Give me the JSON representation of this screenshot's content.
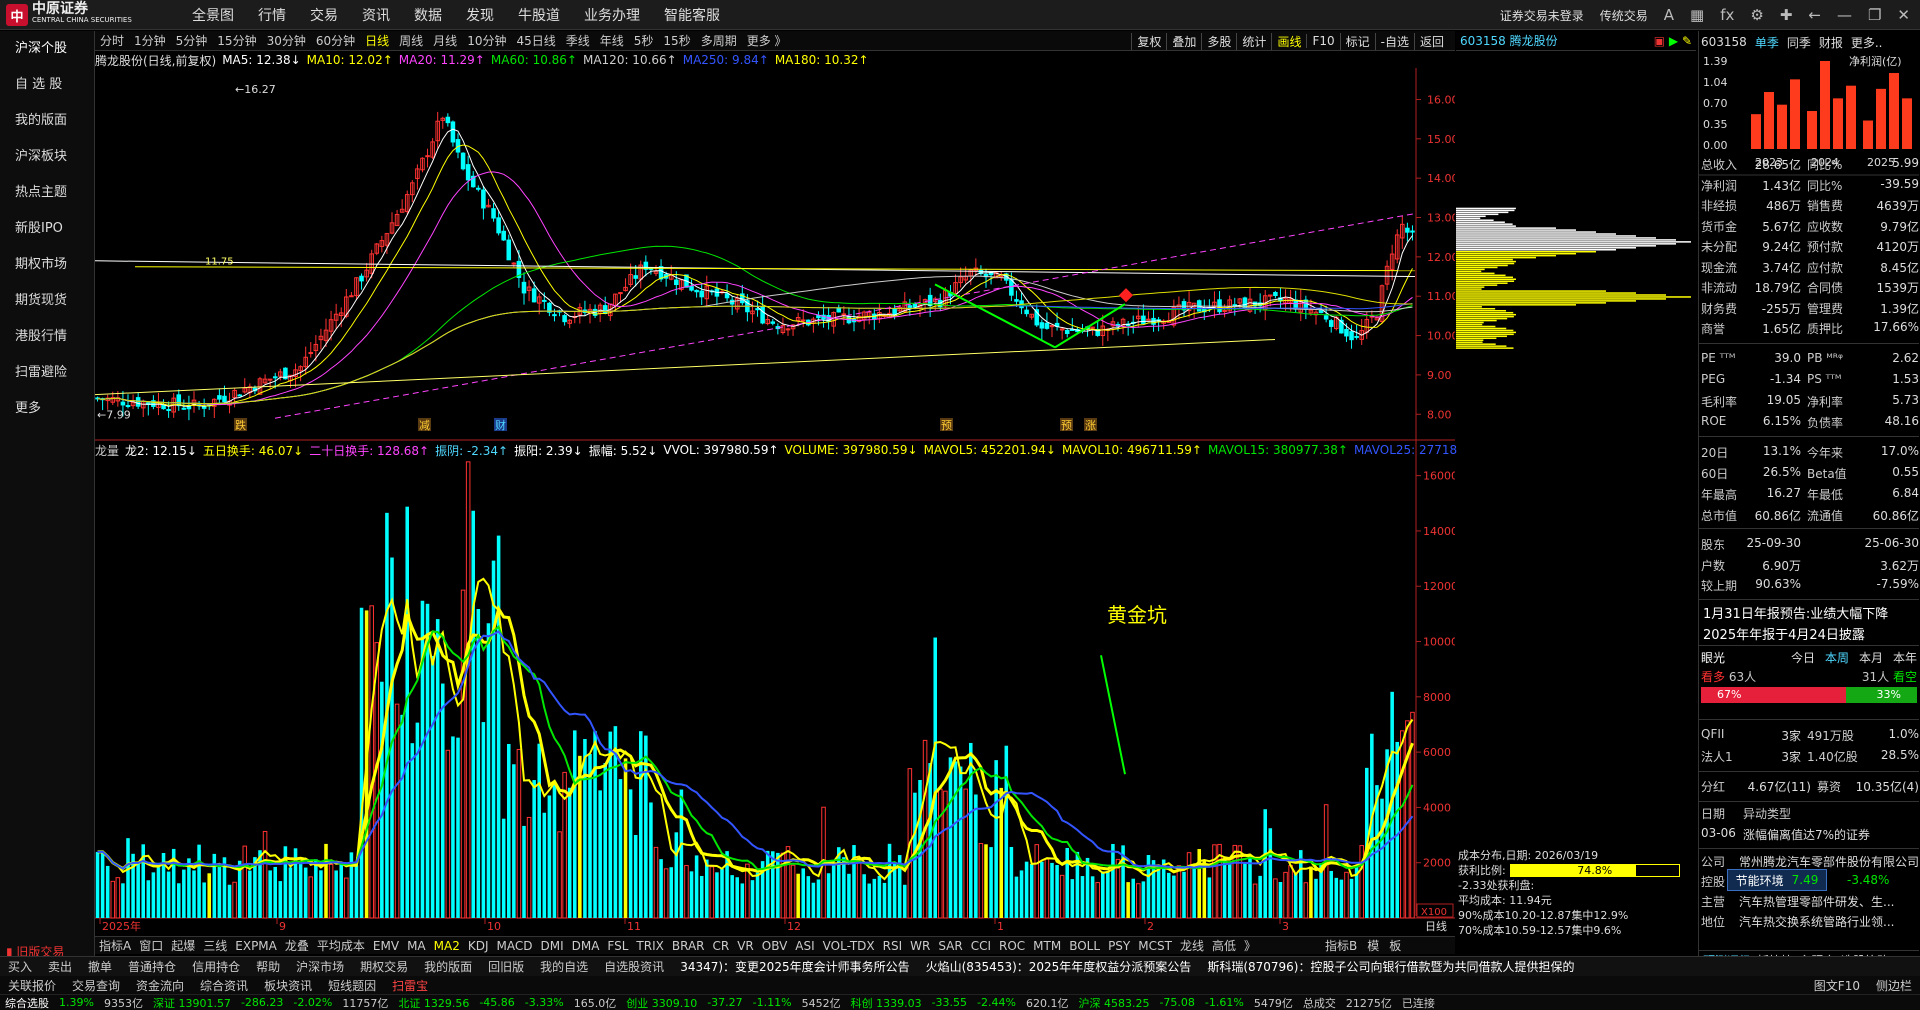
{
  "app": {
    "logo_text": "中原证券",
    "logo_sub": "CENTRAL CHINA SECURITIES"
  },
  "menu": [
    "全景图",
    "行情",
    "交易",
    "资讯",
    "数据",
    "发现",
    "牛股道",
    "业务办理",
    "智能客服"
  ],
  "topright": {
    "login": "证券交易未登录",
    "mode": "传统交易"
  },
  "leftnav": [
    "沪深个股",
    "自 选 股",
    "我的版面",
    "沪深板块",
    "热点主题",
    "新股IPO",
    "期权市场",
    "期货现货",
    "港股行情",
    "扫雷避险",
    "更多"
  ],
  "oldversion": "旧版交易",
  "periods": [
    "分时",
    "1分钟",
    "5分钟",
    "15分钟",
    "30分钟",
    "60分钟",
    "日线",
    "周线",
    "月线",
    "10分钟",
    "45日线",
    "季线",
    "年线",
    "5秒",
    "15秒",
    "多周期",
    "更多 》"
  ],
  "active_period": "日线",
  "chart_tools": [
    "复权",
    "叠加",
    "多股",
    "统计",
    "画线",
    "F10",
    "标记",
    "-自选",
    "返回"
  ],
  "stock": {
    "code": "603158",
    "name": "腾龙股份",
    "title": "腾龙股份(日线,前复权)"
  },
  "ma_legend": [
    {
      "text": "MA5: 12.38↓",
      "color": "#ffffff"
    },
    {
      "text": "MA10: 12.02↑",
      "color": "#ffff00"
    },
    {
      "text": "MA20: 11.29↑",
      "color": "#ff44ff"
    },
    {
      "text": "MA60: 10.86↑",
      "color": "#00e600"
    },
    {
      "text": "MA120: 10.66↑",
      "color": "#cccccc"
    },
    {
      "text": "MA250: 9.84↑",
      "color": "#3355ff"
    },
    {
      "text": "MA180: 10.32↑",
      "color": "#ffff00"
    }
  ],
  "vol_legend": [
    {
      "text": "龙量",
      "color": "#cccccc"
    },
    {
      "text": "龙2: 12.15↓",
      "color": "#ffffff"
    },
    {
      "text": "五日换手: 46.07↓",
      "color": "#ffff00"
    },
    {
      "text": "二十日换手: 128.68↑",
      "color": "#ff44ff"
    },
    {
      "text": "振阴: -2.34↑",
      "color": "#4fd8ff"
    },
    {
      "text": "振阳: 2.39↓",
      "color": "#ffffff"
    },
    {
      "text": "振幅: 5.52↓",
      "color": "#ffffff"
    },
    {
      "text": "VVOL: 397980.59↑",
      "color": "#ffffff"
    },
    {
      "text": "VOLUME: 397980.59↓",
      "color": "#ffff00"
    },
    {
      "text": "MAVOL5: 452201.94↓",
      "color": "#ffff00"
    },
    {
      "text": "MAVOL10: 496711.59↑",
      "color": "#ffff00"
    },
    {
      "text": "MAVOL15: 380977.38↑",
      "color": "#00e600"
    },
    {
      "text": "MAVOL25: 27718",
      "color": "#3355ff"
    }
  ],
  "price_axis": [
    "16.00",
    "15.00",
    "14.00",
    "13.00",
    "12.00",
    "11.00",
    "10.00",
    "9.00",
    "8.00"
  ],
  "vol_axis": [
    "16000",
    "14000",
    "12000",
    "10000",
    "8000",
    "6000",
    "4000",
    "2000"
  ],
  "vol_unit": "X100",
  "x_axis": [
    "2025年",
    "9",
    "10",
    "11",
    "12",
    "1",
    "2",
    "3"
  ],
  "x_right": "日线",
  "annotations": {
    "high": "16.27",
    "low": "7.99",
    "line_val": "11.75",
    "gold": "黄金坑",
    "marks": [
      "跌",
      "减",
      "财",
      "预",
      "预",
      "涨"
    ]
  },
  "chart_data": {
    "type": "candlestick",
    "title": "腾龙股份(日线,前复权)",
    "ylim": [
      7.6,
      16.8
    ],
    "high": 16.27,
    "low": 7.99,
    "volume_ylim": [
      0,
      17000
    ]
  },
  "indicator_tabs": [
    "指标A",
    "窗口",
    "起爆",
    "三线",
    "EXPMA",
    "龙叠",
    "平均成本",
    "EMV",
    "MA",
    "MA2",
    "KDJ",
    "MACD",
    "DMI",
    "DMA",
    "FSL",
    "TRIX",
    "BRAR",
    "CR",
    "VR",
    "OBV",
    "ASI",
    "VOL-TDX",
    "RSI",
    "WR",
    "SAR",
    "CCI",
    "ROC",
    "MTM",
    "BOLL",
    "PSY",
    "MCST",
    "龙线",
    "高低",
    "》"
  ],
  "active_indicator": "MA2",
  "ind_right": [
    "指标B",
    "模",
    "板"
  ],
  "bar2": [
    "买入",
    "卖出",
    "撤单",
    "普通持仓",
    "信用持仓",
    "帮助",
    "沪深市场",
    "期权交易",
    "我的版面",
    "回旧版",
    "我的自选",
    "自选股资讯",
    "34347)：变更2025年度会计师事务所公告",
    "火焰山(835453)：2025年年度权益分派预案公告",
    "斯科瑞(870796)：控股子公司向银行借款暨为共同借款人提供担保的"
  ],
  "bar3": [
    "关联报价",
    "交易查询",
    "资金流向",
    "综合资讯",
    "板块资讯",
    "短线题因",
    "扫雷宝"
  ],
  "bar3_right": [
    "图文F10",
    "侧边栏"
  ],
  "bar4": [
    {
      "t": "综合选股",
      "c": "#ffffff"
    },
    {
      "t": "1.39%",
      "c": "#00e600"
    },
    {
      "t": "9353亿",
      "c": "#cccccc"
    },
    {
      "t": "深证 13901.57",
      "c": "#00e600"
    },
    {
      "t": "-286.23",
      "c": "#00e600"
    },
    {
      "t": "-2.02%",
      "c": "#00e600"
    },
    {
      "t": "11757亿",
      "c": "#cccccc"
    },
    {
      "t": "北证 1329.56",
      "c": "#00e600"
    },
    {
      "t": "-45.86",
      "c": "#00e600"
    },
    {
      "t": "-3.33%",
      "c": "#00e600"
    },
    {
      "t": "165.0亿",
      "c": "#cccccc"
    },
    {
      "t": "创业 3309.10",
      "c": "#00e600"
    },
    {
      "t": "-37.27",
      "c": "#00e600"
    },
    {
      "t": "-1.11%",
      "c": "#00e600"
    },
    {
      "t": "5452亿",
      "c": "#cccccc"
    },
    {
      "t": "科创 1339.03",
      "c": "#00e600"
    },
    {
      "t": "-33.55",
      "c": "#00e600"
    },
    {
      "t": "-2.44%",
      "c": "#00e600"
    },
    {
      "t": "620.1亿",
      "c": "#cccccc"
    },
    {
      "t": "沪深 4583.25",
      "c": "#00e600"
    },
    {
      "t": "-75.08",
      "c": "#00e600"
    },
    {
      "t": "-1.61%",
      "c": "#00e600"
    },
    {
      "t": "5479亿",
      "c": "#cccccc"
    },
    {
      "t": "总成交",
      "c": "#cccccc"
    },
    {
      "t": "21275亿",
      "c": "#cccccc"
    },
    {
      "t": "已连接",
      "c": "#cccccc"
    }
  ],
  "chip": {
    "header": "603158 腾龙股份",
    "date": "成本分布,日期: 2026/03/19",
    "profit_label": "获利比例:",
    "profit_pct": "74.8%",
    "profit_frac": 0.748,
    "loss": "-2.33处获利盘:",
    "avg": "平均成本: 11.94元",
    "c90": "90%成本10.20-12.87集中12.9%",
    "c70": "70%成本10.59-12.57集中9.6%"
  },
  "right": {
    "code": "603158",
    "tabs": [
      "单季",
      "同季",
      "财报",
      "更多.."
    ],
    "tab_active": "单季",
    "bar_title": "净利润(亿)",
    "bar_yticks": [
      "1.39",
      "1.04",
      "0.70",
      "0.35",
      "0.00"
    ],
    "bar_xticks": [
      "2023",
      "2024",
      "2025"
    ],
    "bar_values": [
      0.55,
      0.9,
      0.7,
      1.1,
      0.6,
      1.39,
      0.8,
      1.0,
      0.45,
      0.95,
      1.2,
      0.8
    ],
    "fin": [
      [
        "总收入",
        "28.65亿",
        "同比%",
        "5.99"
      ],
      [
        "净利润",
        "1.43亿",
        "同比%",
        "-39.59"
      ],
      [
        "非经损",
        "486万",
        "销售费",
        "4639万"
      ],
      [
        "货币金",
        "5.67亿",
        "应收数",
        "9.79亿"
      ],
      [
        "未分配",
        "9.24亿",
        "预付款",
        "4120万"
      ],
      [
        "现金流",
        "3.74亿",
        "应付款",
        "8.45亿"
      ],
      [
        "非流动",
        "18.79亿",
        "合同债",
        "1539万"
      ],
      [
        "财务费",
        "-255万",
        "管理费",
        "1.39亿"
      ],
      [
        "商誉",
        "1.65亿",
        "质押比",
        "17.66%"
      ]
    ],
    "fin2": [
      [
        "PE ᵀᵀᴹ",
        "39.0",
        "PB ᴹᴿᵠ",
        "2.62"
      ],
      [
        "PEG",
        "-1.34",
        "PS ᵀᵀᴹ",
        "1.53"
      ],
      [
        "毛利率",
        "19.05",
        "净利率",
        "5.73"
      ],
      [
        "ROE",
        "6.15%",
        "负债率",
        "48.16"
      ]
    ],
    "fin3": [
      [
        "20日",
        "13.1%",
        "今年来",
        "17.0%"
      ],
      [
        "60日",
        "26.5%",
        "Beta值",
        "0.55"
      ],
      [
        "年最高",
        "16.27",
        "年最低",
        "6.84"
      ],
      [
        "总市值",
        "60.86亿",
        "流通值",
        "60.86亿"
      ]
    ],
    "fin4": [
      [
        "股东",
        "25-09-30",
        "",
        "25-06-30"
      ],
      [
        "户数",
        "6.90万",
        "",
        "3.62万"
      ],
      [
        "较上期",
        "90.63%",
        "",
        "-7.59%"
      ]
    ],
    "notice1": "1月31日年报预告:业绩大幅下降",
    "notice2": "2025年年报于4月24日披露",
    "eye": {
      "label": "眼光",
      "tabs": [
        "今日",
        "本周",
        "本月",
        "本年"
      ],
      "active": "本周",
      "bull": "看多",
      "bull_n": "63人",
      "bear_n": "31人",
      "bear": "看空",
      "bull_pct": "67%",
      "bear_pct": "33%",
      "bull_frac": 0.67
    },
    "qfii": [
      [
        "QFII",
        "3家",
        "491万股",
        "1.0%"
      ],
      [
        "法人1",
        "3家",
        "1.40亿股",
        "28.5%"
      ]
    ],
    "fenhong": [
      "分红",
      "4.67亿(11)",
      "募资",
      "10.35亿(4)"
    ],
    "event": {
      "k1": "日期",
      "v1": "异动类型",
      "k2": "03-06",
      "v2": "涨幅偏离值达7%的证券"
    },
    "company": [
      [
        "公司",
        "常州腾龙汽车零部件股份有限公司"
      ],
      [
        "控股",
        ""
      ],
      [
        "主营",
        "汽车热管理零部件研发、生..."
      ],
      [
        "地位",
        "汽车热交换系统管路行业领..."
      ]
    ],
    "popup": {
      "label": "节能环境",
      "v": "7.49",
      "pct": "-3.48%"
    },
    "bottom": [
      "预测评级",
      "板块块",
      "主题库",
      "选股策略"
    ]
  }
}
